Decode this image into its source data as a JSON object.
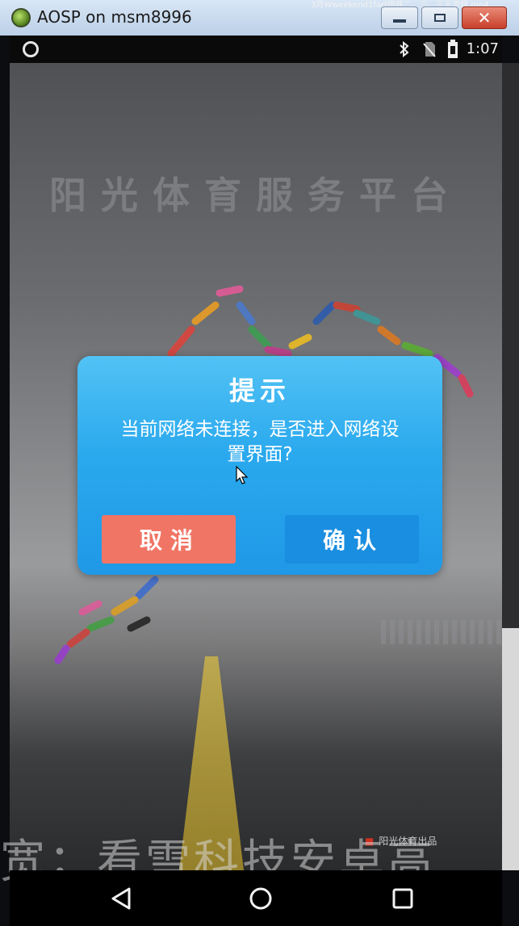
{
  "window": {
    "title": "AOSP on msm8996",
    "video_caption": "3月Wweekend1fart组件二、三、三王流程.mp4",
    "close_label": "✕"
  },
  "statusbar": {
    "time": "1:07",
    "icons": [
      "bluetooth-icon",
      "no-sim-icon",
      "battery-icon"
    ]
  },
  "app": {
    "splash_title": "阳光体育服务平台",
    "brand_text": "阳光体育出品"
  },
  "dialog": {
    "title": "提示",
    "message": "当前网络未连接，是否进入网络设置界面?",
    "cancel_label": "取消",
    "confirm_label": "确认",
    "colors": {
      "background": "#2aa9ee",
      "cancel": "#f07565",
      "confirm": "#1a8ee0"
    }
  },
  "overlay": {
    "watermark": "宽；看雪科技安卓高"
  },
  "navbar": {
    "buttons": [
      "back-icon",
      "home-icon",
      "recent-apps-icon"
    ]
  }
}
